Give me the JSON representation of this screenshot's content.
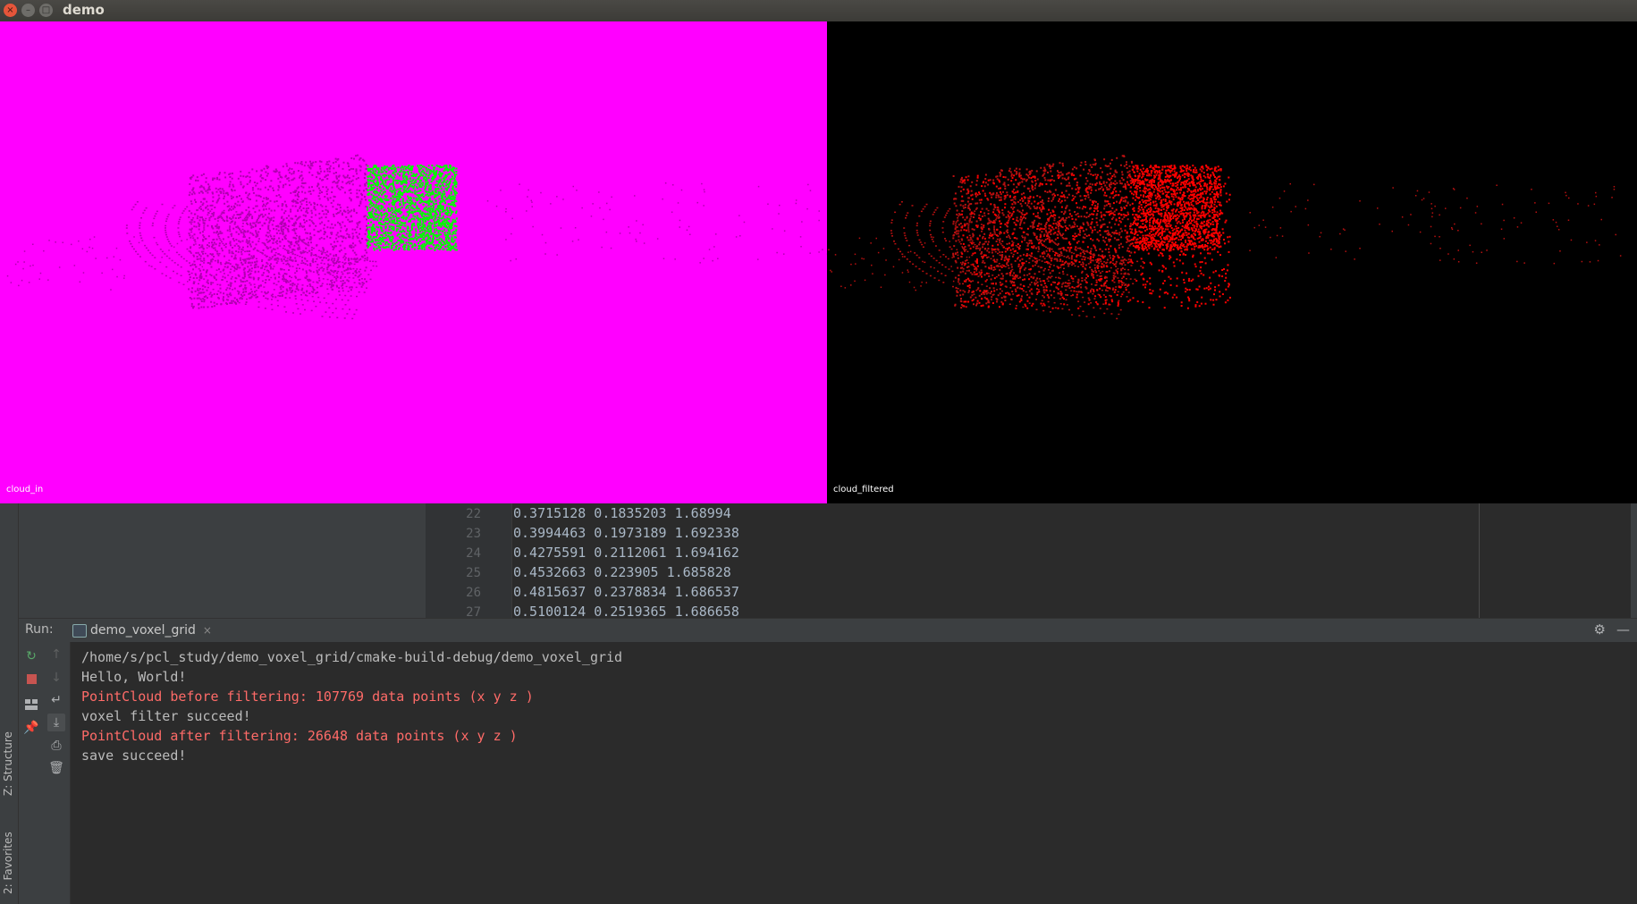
{
  "window": {
    "title": "demo",
    "controls": {
      "close": "×",
      "minimize": "–",
      "maximize": "□"
    }
  },
  "viewports": [
    {
      "label": "cloud_in",
      "background": "#ff00ff",
      "point_color": "#00ff00",
      "overlay_color": "#b000b0"
    },
    {
      "label": "cloud_filtered",
      "background": "#000000",
      "point_color": "#ff0000"
    }
  ],
  "editor": {
    "lines": [
      {
        "num": "22",
        "text": "0.3715128 0.1835203 1.68994"
      },
      {
        "num": "23",
        "text": "0.3994463 0.1973189 1.692338"
      },
      {
        "num": "24",
        "text": "0.4275591 0.2112061 1.694162"
      },
      {
        "num": "25",
        "text": "0.4532663 0.223905 1.685828"
      },
      {
        "num": "26",
        "text": "0.4815637 0.2378834 1.686537"
      },
      {
        "num": "27",
        "text": "0.5100124 0.2519365 1.686658"
      }
    ]
  },
  "run": {
    "label": "Run:",
    "tab_label": "demo_voxel_grid",
    "tab_close": "×",
    "settings_icon": "gear-icon",
    "hide_icon": "minimize-icon"
  },
  "console": {
    "lines": [
      {
        "text": "/home/s/pcl_study/demo_voxel_grid/cmake-build-debug/demo_voxel_grid",
        "type": "normal"
      },
      {
        "text": "Hello, World!",
        "type": "normal"
      },
      {
        "text": "PointCloud before filtering: 107769 data points (x y z )",
        "type": "error"
      },
      {
        "text": "voxel filter succeed!",
        "type": "normal"
      },
      {
        "text": "PointCloud after filtering: 26648 data points (x y z )",
        "type": "error"
      },
      {
        "text": "save succeed!",
        "type": "normal"
      }
    ]
  },
  "side_tabs": {
    "structure": "Z: Structure",
    "favorites": "2: Favorites"
  },
  "colors": {
    "console_error": "#ff6b68",
    "console_normal": "#bbbbbb",
    "rerun": "#59a869",
    "stop": "#c75450"
  }
}
